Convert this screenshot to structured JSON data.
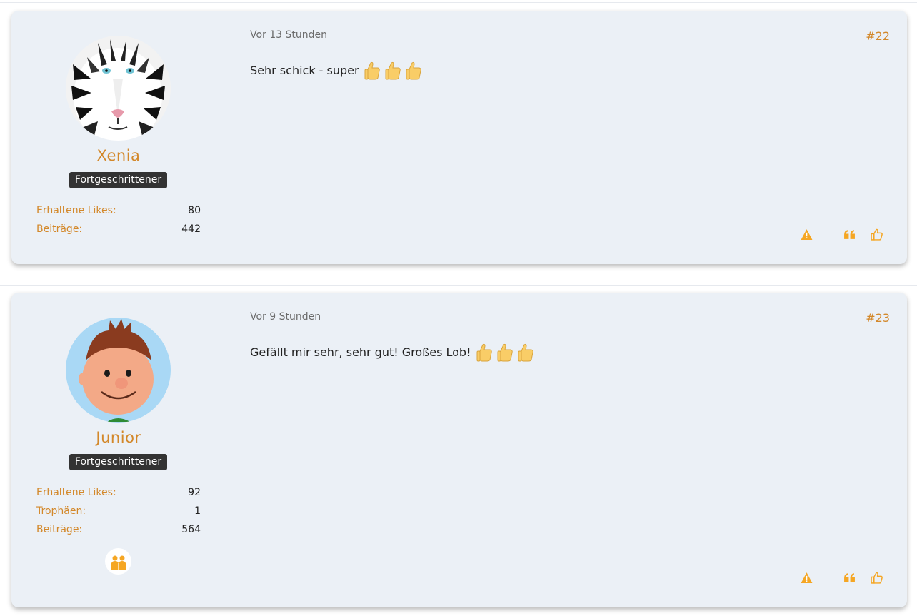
{
  "posts": [
    {
      "username": "Xenia",
      "rank": "Fortgeschrittener",
      "stats": [
        {
          "label": "Erhaltene Likes:",
          "value": "80"
        },
        {
          "label": "Beiträge:",
          "value": "442"
        }
      ],
      "time": "Vor 13 Stunden",
      "number": "#22",
      "text": "Sehr schick - super",
      "avatar_icon": "white-tiger-avatar",
      "thumb_count": 3
    },
    {
      "username": "Junior",
      "rank": "Fortgeschrittener",
      "stats": [
        {
          "label": "Erhaltene Likes:",
          "value": "92"
        },
        {
          "label": "Trophäen:",
          "value": "1"
        },
        {
          "label": "Beiträge:",
          "value": "564"
        }
      ],
      "time": "Vor 9 Stunden",
      "number": "#23",
      "text": "Gefällt mir sehr, sehr gut! Großes Lob!",
      "avatar_icon": "cartoon-boy-avatar",
      "thumb_count": 3,
      "trophy_icon": "community-trophy-icon"
    }
  ],
  "colors": {
    "accent": "#d3882a",
    "card": "#ebf0f6",
    "rank_bg": "#333333",
    "action": "#f5a623"
  },
  "actions": [
    "report-icon",
    "quote-icon",
    "like-icon"
  ]
}
